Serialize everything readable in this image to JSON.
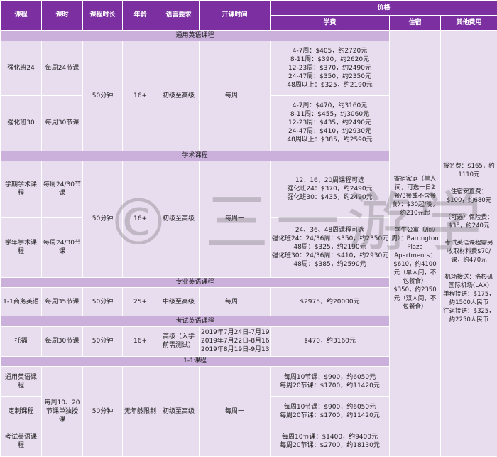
{
  "headers": {
    "course": "课程",
    "hours": "课时",
    "duration": "课程时长",
    "age": "年龄",
    "language": "语言要求",
    "start": "开课时间",
    "price": "价格",
    "tuition": "学费",
    "housing": "住宿",
    "other": "其他费用"
  },
  "sections": {
    "general": "通用英语课程",
    "academic": "学术课程",
    "professional": "专业英语课程",
    "exam": "考试英语课程",
    "oneone": "1-1课程"
  },
  "general": {
    "duration": "50分钟",
    "age": "16+",
    "language": "初级至高级",
    "start": "每周一",
    "rows": [
      {
        "course": "强化班24",
        "hours": "每周24节课",
        "fees": [
          "4-7周：$405，约2720元",
          "8-11周：$390，约2620元",
          "12-23周：$370，约2490元",
          "24-47周：$350，约2350元",
          "48周以上：$325，约2190元"
        ]
      },
      {
        "course": "强化班30",
        "hours": "每周30节课",
        "fees": [
          "4-7周：$470，约3160元",
          "8-11周：$455，约3060元",
          "12-23周：$435，约2490元",
          "24-47周：$410，约2930元",
          "48周以上：$385，约2590元"
        ]
      }
    ]
  },
  "academic": {
    "duration": "50分钟",
    "age": "16+",
    "language": "初级至高级",
    "start": "每周一",
    "rows": [
      {
        "course": "学期学术课程",
        "hours": "每周24/30节课",
        "fees": [
          "12、16、20周课程可选",
          "强化班24：$370，约2490元",
          "强化班30：$435，约2490元"
        ]
      },
      {
        "course": "学年学术课程",
        "hours": "每周24/30节课",
        "fees": [
          "24、36、48周课程可选",
          "强化班24：24/36周：$350，约2350元",
          "48周：$325，约2190元",
          "强化班30：24/36周：$410，约2930元",
          "48周：$385，约2590元"
        ]
      }
    ]
  },
  "professional": {
    "course": "1-1商务英语",
    "hours": "每周35节课",
    "duration": "50分钟",
    "age": "25+",
    "language": "中级至高级",
    "start": "每周一",
    "fee": "$2975，约20000元"
  },
  "exam": {
    "course": "托福",
    "hours": "每周30节课",
    "duration": "50分钟",
    "age": "16+",
    "language": "高级（入学前需测试）",
    "dates": [
      "2019年7月24日-7月19日",
      "2019年7月22日-8月16日",
      "2019年8月19日-9月13日"
    ],
    "fee": "$470，约3160元"
  },
  "oneone": {
    "hours": "每周10、20节课单独授课",
    "duration": "50分钟",
    "age": "无年龄限制",
    "language": "初级至高级",
    "start": "每周一",
    "rows": [
      {
        "course": "通用英语课程",
        "fees": [
          "每周10节课：$900，约6050元",
          "每周20节课：$1700，约11420元"
        ]
      },
      {
        "course": "定制课程",
        "fees": [
          "每周10节课：$900，约6050元",
          "每周20节课：$1700，约11420元"
        ]
      },
      {
        "course": "考试英语课程",
        "fees": [
          "每周10节课：$1400，约9400元",
          "每周20节课：$2700，约18130元"
        ]
      }
    ]
  },
  "housing": {
    "text": "寄宿家庭（单人间，可选一日2餐/3餐或不含餐食）：$30起/晚，约210元起\n\n学生公寓（/间/周）：Barrington Plaza Apartments：$610，约4100元（单人间，不包餐食）\n$350，约2350元（双人间，不包餐食）"
  },
  "other": {
    "text": "报名费：$165，约1110元\n\n住宿安置费：$100，约680元\n\n（可选）保险费：$35，约240元\n\n考试英语课程需另收取材料费$70/课，约470元\n\n机场接送：洛杉矶国际机场(LAX)\n单程接送：$175，约1500人民币\n往返接送：$325，约2250人民币"
  },
  "watermark": "© 三一游学"
}
